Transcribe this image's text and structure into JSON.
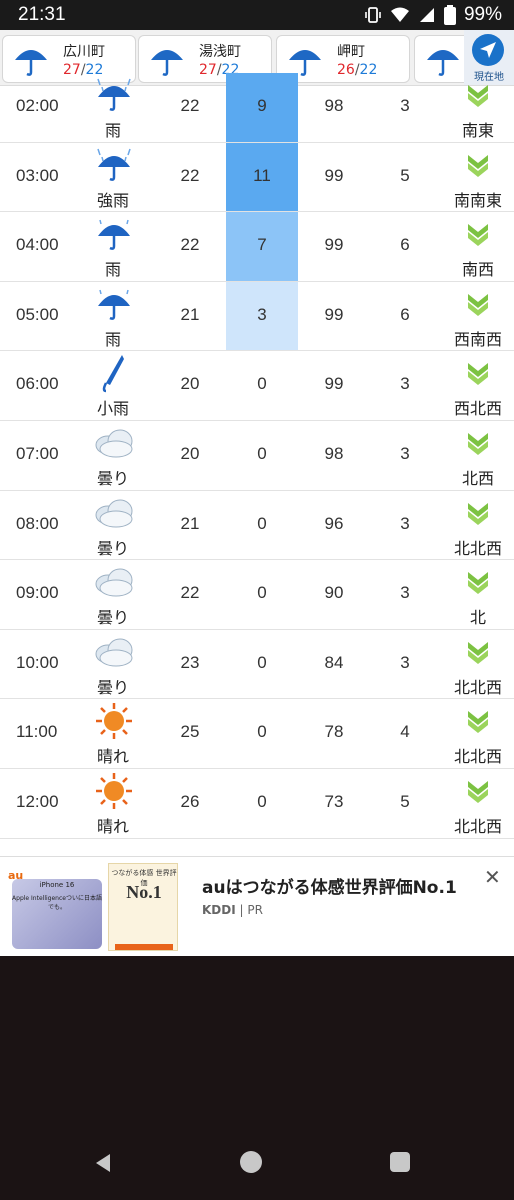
{
  "status": {
    "time": "21:31",
    "battery": "99%"
  },
  "locations": [
    {
      "name": "広川町",
      "hi": "27",
      "lo": "22"
    },
    {
      "name": "湯浅町",
      "hi": "27",
      "lo": "22"
    },
    {
      "name": "岬町",
      "hi": "26",
      "lo": "22"
    }
  ],
  "current_location_label": "現在地",
  "sep": "/",
  "rows": [
    {
      "time": "02:00",
      "weather": "雨",
      "icon": "heavy-rain-umbrella-icon",
      "temp": "22",
      "precip": "9",
      "precip_level": 9,
      "humidity": "98",
      "wind": "3",
      "dir": "南東",
      "dir_icon": "wind-arrow-icon"
    },
    {
      "time": "03:00",
      "weather": "強雨",
      "icon": "heavy-rain-umbrella-icon",
      "temp": "22",
      "precip": "11",
      "precip_level": 11,
      "humidity": "99",
      "wind": "5",
      "dir": "南南東",
      "dir_icon": "wind-arrow-icon"
    },
    {
      "time": "04:00",
      "weather": "雨",
      "icon": "rain-umbrella-icon",
      "temp": "22",
      "precip": "7",
      "precip_level": 7,
      "humidity": "99",
      "wind": "6",
      "dir": "南西",
      "dir_icon": "wind-arrow-icon"
    },
    {
      "time": "05:00",
      "weather": "雨",
      "icon": "rain-umbrella-icon",
      "temp": "21",
      "precip": "3",
      "precip_level": 3,
      "humidity": "99",
      "wind": "6",
      "dir": "西南西",
      "dir_icon": "wind-arrow-icon"
    },
    {
      "time": "06:00",
      "weather": "小雨",
      "icon": "closed-umbrella-icon",
      "temp": "20",
      "precip": "0",
      "precip_level": 0,
      "humidity": "99",
      "wind": "3",
      "dir": "西北西",
      "dir_icon": "wind-arrow-icon"
    },
    {
      "time": "07:00",
      "weather": "曇り",
      "icon": "cloud-icon",
      "temp": "20",
      "precip": "0",
      "precip_level": 0,
      "humidity": "98",
      "wind": "3",
      "dir": "北西",
      "dir_icon": "wind-arrow-icon"
    },
    {
      "time": "08:00",
      "weather": "曇り",
      "icon": "cloud-icon",
      "temp": "21",
      "precip": "0",
      "precip_level": 0,
      "humidity": "96",
      "wind": "3",
      "dir": "北北西",
      "dir_icon": "wind-arrow-icon"
    },
    {
      "time": "09:00",
      "weather": "曇り",
      "icon": "cloud-icon",
      "temp": "22",
      "precip": "0",
      "precip_level": 0,
      "humidity": "90",
      "wind": "3",
      "dir": "北",
      "dir_icon": "wind-arrow-icon"
    },
    {
      "time": "10:00",
      "weather": "曇り",
      "icon": "cloud-icon",
      "temp": "23",
      "precip": "0",
      "precip_level": 0,
      "humidity": "84",
      "wind": "3",
      "dir": "北北西",
      "dir_icon": "wind-arrow-icon"
    },
    {
      "time": "11:00",
      "weather": "晴れ",
      "icon": "sun-icon",
      "temp": "25",
      "precip": "0",
      "precip_level": 0,
      "humidity": "78",
      "wind": "4",
      "dir": "北北西",
      "dir_icon": "wind-arrow-icon"
    },
    {
      "time": "12:00",
      "weather": "晴れ",
      "icon": "sun-icon",
      "temp": "26",
      "precip": "0",
      "precip_level": 0,
      "humidity": "73",
      "wind": "5",
      "dir": "北北西",
      "dir_icon": "wind-arrow-icon"
    }
  ],
  "ad": {
    "brand": "au",
    "phone_title": "iPhone 16",
    "phone_sub": "Apple Intelligenceついに日本語でも。",
    "badge_title": "つながる体感 世界評価",
    "badge_rank": "No.1",
    "headline": "auはつながる体感世界評価No.1",
    "sponsor": "KDDI",
    "pr": "PR",
    "close": "✕"
  },
  "colors": {
    "precip_strong": "#5aa9f0",
    "precip_mid": "#8cc4f7",
    "precip_light": "#cfe5fb",
    "accent": "#1a72c9",
    "wind_green": "#7cc242"
  }
}
